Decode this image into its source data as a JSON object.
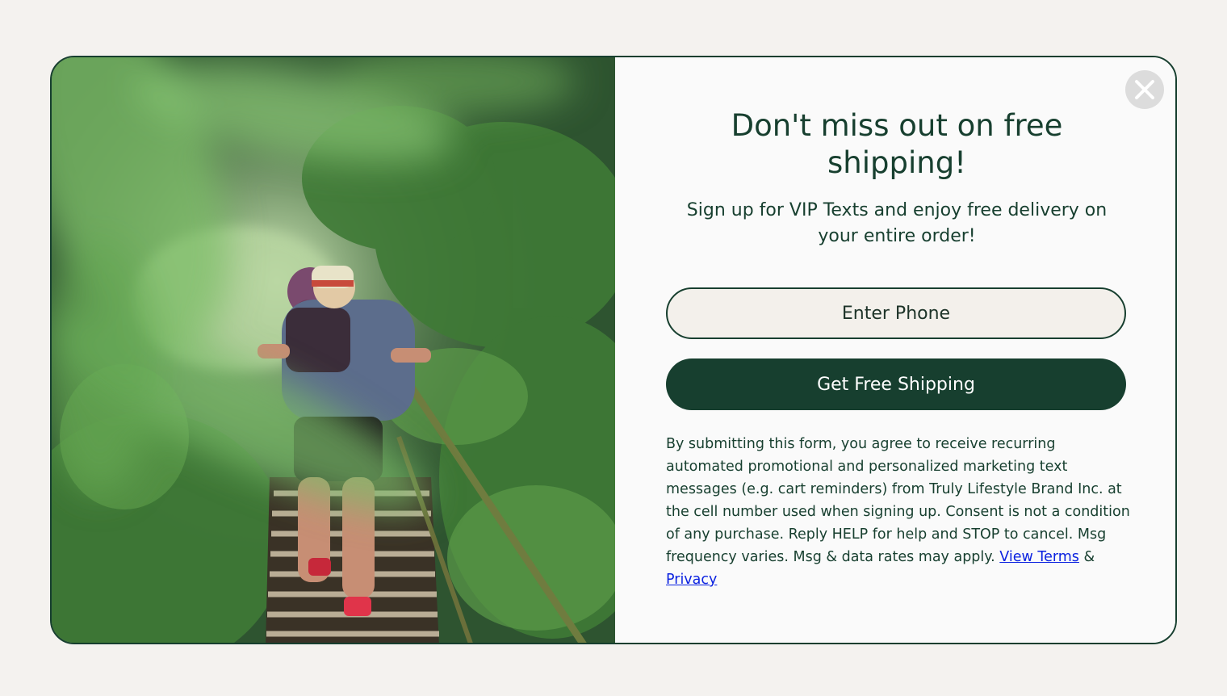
{
  "popup": {
    "headline": "Don't miss out on free shipping!",
    "subhead": "Sign up for VIP Texts and enjoy free delivery on your entire order!",
    "phone_placeholder": "Enter Phone",
    "cta_label": "Get Free Shipping",
    "legal_text": "By submitting this form, you agree to receive recurring automated promotional and personalized marketing text messages (e.g. cart reminders) from Truly Lifestyle Brand Inc. at the cell number used when signing up. Consent is not a condition of any purchase. Reply HELP for help and STOP to cancel. Msg frequency varies. Msg & data rates may apply.",
    "terms_link": "View Terms",
    "ampersand": "&",
    "privacy_link": "Privacy",
    "close_icon": "close-icon",
    "image": "hikers-forest-stairs-photo"
  },
  "colors": {
    "brand_dark_green": "#173f2f",
    "link_blue": "#0b22e0",
    "input_bg": "#f3f0eb",
    "page_bg": "#f4f2ef"
  }
}
